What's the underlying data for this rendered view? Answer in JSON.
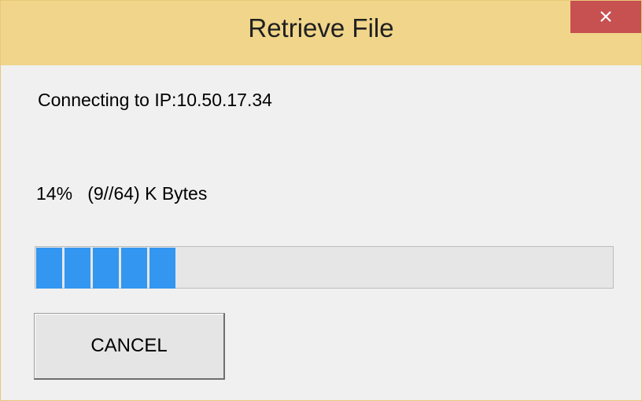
{
  "window": {
    "title": "Retrieve File",
    "close_icon": "close-icon"
  },
  "status": {
    "text": "Connecting to IP:10.50.17.34"
  },
  "progress": {
    "percent_label": "14%",
    "detail_label": "(9//64) K Bytes",
    "fraction": 0.14,
    "fill_color": "#3396f0"
  },
  "buttons": {
    "cancel_label": "CANCEL"
  },
  "colors": {
    "titlebar": "#f0d58a",
    "close_button": "#c75050",
    "dialog_background": "#f0f0f0"
  }
}
